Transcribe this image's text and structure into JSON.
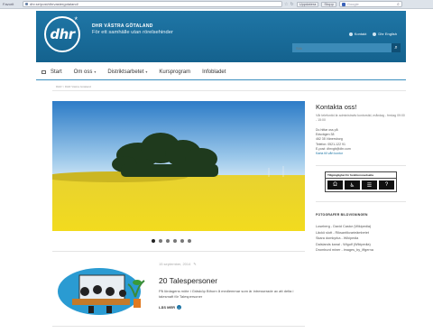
{
  "browser": {
    "menu_label": "Favorit",
    "url": "dhr.se/post/dhrvastergotaland/",
    "toolbar_buttons": [
      "Uppdatera",
      "Stopp"
    ],
    "search_placeholder": "Google"
  },
  "header": {
    "logo_text": "dhr",
    "logo_star": "*",
    "org_name": "DHR VÄSTRA GÖTALAND",
    "tagline": "För ett samhälle utan rörelsehinder",
    "links": [
      "Kontakt",
      "Dhr English"
    ],
    "search_placeholder": "Sök",
    "search_button": "⌕"
  },
  "nav": {
    "items": [
      {
        "label": "Start",
        "has_caret": false
      },
      {
        "label": "Om oss",
        "has_caret": true
      },
      {
        "label": "Distriktsarbetet",
        "has_caret": true
      },
      {
        "label": "Kursprogram",
        "has_caret": false
      },
      {
        "label": "Infobladet",
        "has_caret": false
      }
    ],
    "accent_color": "#1f76a6"
  },
  "breadcrumb": "DHR > DHR Västra Götaland",
  "slider": {
    "dots": 6,
    "active_index": 0
  },
  "article": {
    "date": "15 september, 2014",
    "title": "20 Talespersoner",
    "text": "På lördagens möte i Gräsköp Bthorn å medlemmar som är intresserade av att delta i talesmaft för Talespersoner",
    "more": "LÄS MER"
  },
  "sidebar": {
    "title": "Kontakta oss!",
    "subtitle": "Vår telefontid är administrativ kontorstid, måndag - fredag 09:00 - 15:00",
    "address_lines": [
      "Du hittar oss på",
      "Edsvägen 38",
      "462 35 Vänersborg",
      "Telefon: 0521-122 91",
      "E-post: dhrvgb@dhr.com"
    ],
    "map_link": "Karta till vårt kontor",
    "accessibility_title": "Tillgänglighet för funktionsnedsatta",
    "accessibility_icons": [
      "Ω",
      "♿",
      "☰",
      "?"
    ],
    "photo_title": "FOTOGRAFER BILDVISNINGEN",
    "photo_credits": [
      "Loseberg - David Castor (Wikipedia)",
      "Läckö slott - Riksantikvarieämbetet",
      "Skara domkyrka - Wikipedia",
      "Dalslands kanal - Wigulf (Wikipedia)",
      "Dromburd miner - images_by_iffgerna"
    ]
  }
}
